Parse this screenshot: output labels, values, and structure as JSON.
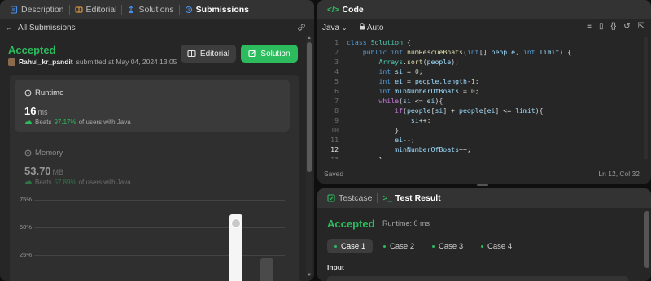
{
  "colors": {
    "accent_green": "#2cbb5d",
    "panel_bg": "#262626",
    "tab_bg": "#333333",
    "code_keyword": "#c678dd",
    "code_number": "#b5cea8"
  },
  "left_tabs": [
    {
      "label": "Description",
      "icon": "description-icon"
    },
    {
      "label": "Editorial",
      "icon": "editorial-icon"
    },
    {
      "label": "Solutions",
      "icon": "solutions-icon"
    },
    {
      "label": "Submissions",
      "icon": "submissions-icon",
      "active": true
    }
  ],
  "submissions_bar": {
    "back_label": "All Submissions",
    "link_icon": "link-icon"
  },
  "submission": {
    "status": "Accepted",
    "author": "Rahul_kr_pandit",
    "submitted_text": "submitted at May 04, 2024 13:05",
    "editorial_button": "Editorial",
    "solution_button": "Solution"
  },
  "runtime": {
    "label": "Runtime",
    "value": "16",
    "unit": "ms",
    "beats_prefix": "Beats",
    "beats_pct": "97.17%",
    "beats_suffix": "of users with Java"
  },
  "memory": {
    "label": "Memory",
    "value": "53.70",
    "unit": "MB",
    "beats_prefix": "Beats",
    "beats_pct": "57.89%",
    "beats_suffix": "of users with Java"
  },
  "chart_data": {
    "type": "bar",
    "y_ticks": [
      "75%",
      "50%",
      "25%"
    ],
    "bars": [
      {
        "value": 62,
        "highlight": true
      },
      {
        "value": 22,
        "highlight": false
      }
    ],
    "ylim": [
      0,
      100
    ]
  },
  "code_panel": {
    "title": "Code",
    "language": "Java",
    "auto_label": "Auto",
    "toolbar_icons": [
      "format-icon",
      "bookmark-icon",
      "braces-icon",
      "reset-icon",
      "expand-icon"
    ],
    "lines": [
      "class Solution {",
      "    public int numRescueBoats(int[] people, int limit) {",
      "        Arrays.sort(people);",
      "        int si = 0;",
      "        int ei = people.length-1;",
      "        int minNumberOfBoats = 0;",
      "        while(si <= ei){",
      "            if(people[si] + people[ei] <= limit){",
      "                si++;",
      "            }",
      "            ei--;",
      "            minNumberOfBoats++;",
      "        }"
    ],
    "line_numbers": [
      "1",
      "2",
      "3",
      "4",
      "5",
      "6",
      "7",
      "8",
      "9",
      "10",
      "11",
      "12",
      "13"
    ],
    "current_line": 12,
    "status_left": "Saved",
    "status_right": "Ln 12, Col 32"
  },
  "test_panel": {
    "tabs": [
      {
        "label": "Testcase",
        "icon": "testcase-icon"
      },
      {
        "label": "Test Result",
        "icon": "terminal-icon",
        "active": true
      }
    ],
    "status": "Accepted",
    "runtime_text": "Runtime: 0 ms",
    "cases": [
      "Case 1",
      "Case 2",
      "Case 3",
      "Case 4"
    ],
    "active_case": 0,
    "input_label": "Input"
  }
}
